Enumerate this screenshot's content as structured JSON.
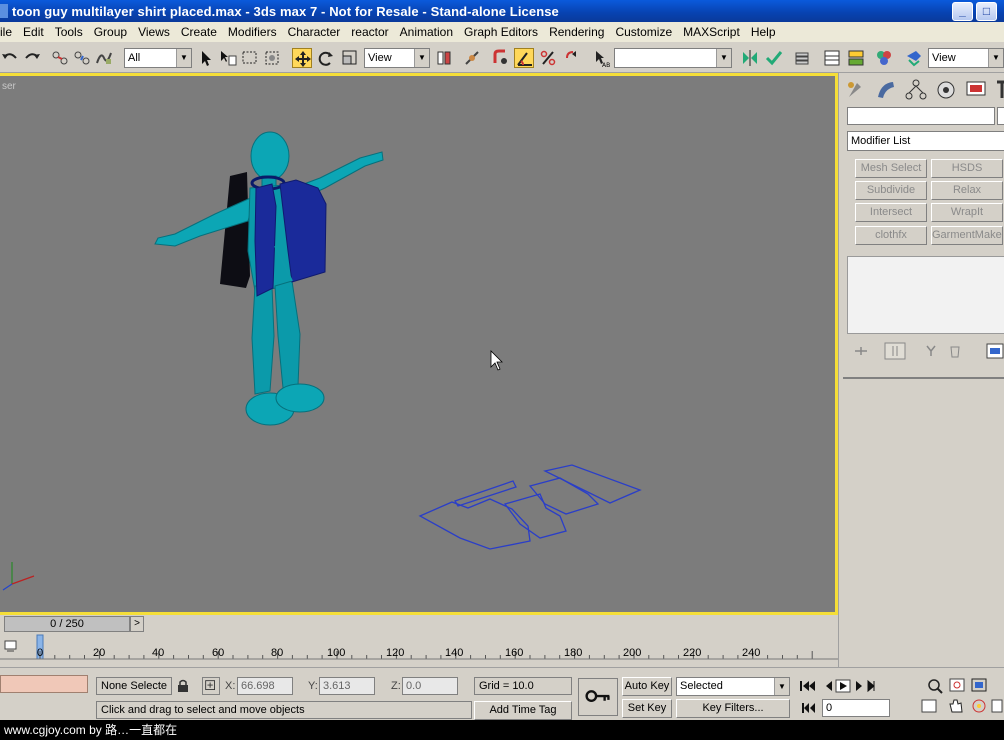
{
  "window": {
    "title": "toon guy multilayer shirt placed.max - 3ds max 7 - Not for Resale - Stand-alone License",
    "minimize": "_",
    "maximize": "□"
  },
  "menu": [
    "ile",
    "Edit",
    "Tools",
    "Group",
    "Views",
    "Create",
    "Modifiers",
    "Character",
    "reactor",
    "Animation",
    "Graph Editors",
    "Rendering",
    "Customize",
    "MAXScript",
    "Help"
  ],
  "toolbar": {
    "selection_filter": "All",
    "ref_coord_system": "View",
    "named_sel_set": "",
    "view_dropdown": "View",
    "colors": {
      "accent_active": "#ffd85a"
    }
  },
  "viewport": {
    "label": "ser",
    "border_color": "#f5de38",
    "background": "#7c7c7c",
    "character_color": "#0a9aa8",
    "shirt_color": "#1a2a9a"
  },
  "command_panel": {
    "modifier_list": "Modifier List",
    "buttons": [
      "Mesh Select",
      "HSDS",
      "Subdivide",
      "Relax",
      "Intersect",
      "WrapIt",
      "clothfx",
      "GarmentMaker"
    ]
  },
  "time": {
    "slider_label": "0 / 250",
    "next_arrow": ">",
    "ticks": [
      "0",
      "20",
      "40",
      "60",
      "80",
      "100",
      "120",
      "140",
      "160",
      "180",
      "200",
      "220",
      "240"
    ]
  },
  "status": {
    "selection": "None Selecte",
    "x_label": "X:",
    "x_value": "66.698",
    "y_label": "Y:",
    "y_value": "3.613",
    "z_label": "Z:",
    "z_value": "0.0",
    "grid": "Grid = 10.0",
    "prompt": "Click and drag to select and move objects",
    "add_time_tag": "Add Time Tag",
    "auto_key": "Auto Key",
    "set_key": "Set Key",
    "key_mode": "Selected",
    "key_filters": "Key Filters...",
    "frame": "0"
  },
  "watermark": "www.cgjoy.com by 路…一直都在"
}
